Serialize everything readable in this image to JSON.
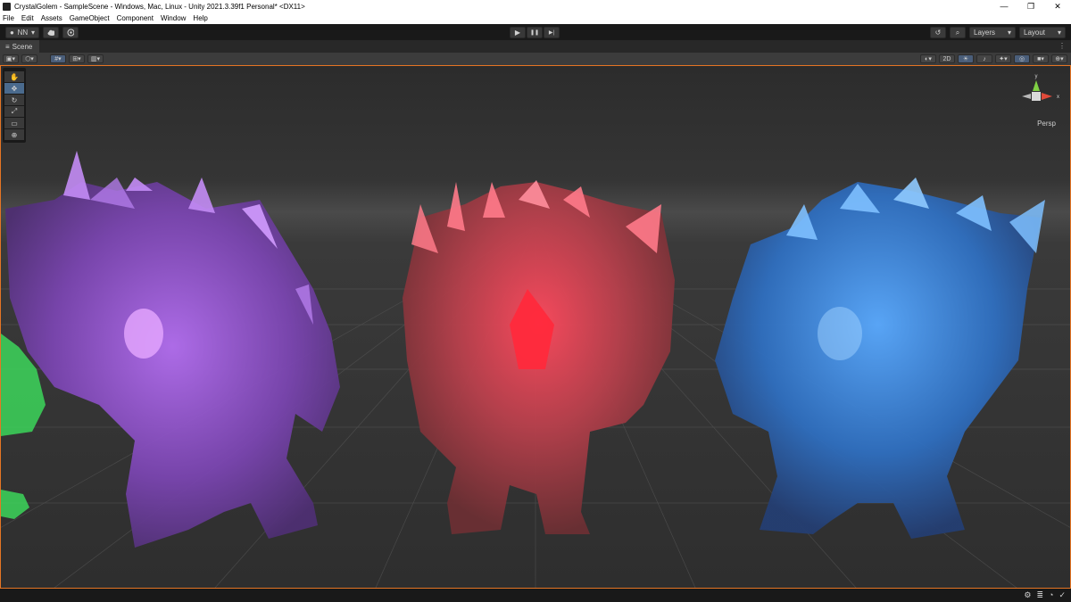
{
  "window": {
    "title": "CrystalGolem - SampleScene - Windows, Mac, Linux - Unity 2021.3.39f1 Personal* <DX11>",
    "minimize": "—",
    "maximize": "❐",
    "close": "✕"
  },
  "menu": [
    "File",
    "Edit",
    "Assets",
    "GameObject",
    "Component",
    "Window",
    "Help"
  ],
  "toolbar": {
    "account_label": "NN",
    "account_caret": "▾",
    "cloud_icon": "cloud-icon",
    "collab_icon": "collab-icon",
    "play_icon": "▶",
    "pause_icon": "❚❚",
    "step_icon": "▶|",
    "history_icon": "↺",
    "search_icon": "⌕",
    "layers_label": "Layers",
    "layout_label": "Layout",
    "caret": "▾"
  },
  "tab": {
    "label": "Scene",
    "icon": "≡",
    "menu": "⋮"
  },
  "scene_toolbar": {
    "mode_2d": "2D"
  },
  "tools": [
    "hand",
    "move",
    "rotate",
    "scale",
    "rect",
    "transform"
  ],
  "tool_glyphs": [
    "✋",
    "✥",
    "↻",
    "⤢",
    "▭",
    "⊕"
  ],
  "gizmo": {
    "y_label": "y",
    "x_label": "x",
    "persp_label": "Persp",
    "lock": "🔒"
  },
  "colors": {
    "accent": "#e57524",
    "purple": "#9b57d8",
    "red": "#e0475b",
    "blue": "#3f8ee8",
    "green": "#3cd65a"
  }
}
